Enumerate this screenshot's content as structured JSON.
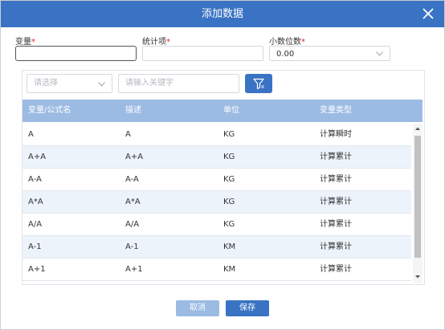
{
  "dialog": {
    "title": "添加数据",
    "close_icon": "close-icon"
  },
  "form": {
    "variable_label": "变量",
    "stat_item_label": "统计项",
    "decimal_label": "小数位数",
    "required_mark": "*",
    "variable_value": "",
    "stat_item_value": "",
    "decimal_value": "0.00"
  },
  "filter": {
    "select_placeholder": "请选择",
    "search_placeholder": "请输入关键字",
    "filter_icon": "filter-icon"
  },
  "table": {
    "headers": [
      "变量/公式名",
      "描述",
      "单位",
      "变量类型"
    ],
    "rows": [
      [
        "A",
        "A",
        "KG",
        "计算瞬时"
      ],
      [
        "A+A",
        "A+A",
        "KG",
        "计算累计"
      ],
      [
        "A-A",
        "A-A",
        "KG",
        "计算累计"
      ],
      [
        "A*A",
        "A*A",
        "KG",
        "计算累计"
      ],
      [
        "A/A",
        "A/A",
        "KG",
        "计算累计"
      ],
      [
        "A-1",
        "A-1",
        "KM",
        "计算累计"
      ],
      [
        "A+1",
        "A+1",
        "KM",
        "计算累计"
      ]
    ]
  },
  "footer": {
    "cancel_label": "取消",
    "save_label": "保存"
  },
  "colors": {
    "accent": "#3a73c4",
    "header_bg": "#9cbbe3",
    "stripe": "#edf3fb",
    "required": "#e02020"
  }
}
